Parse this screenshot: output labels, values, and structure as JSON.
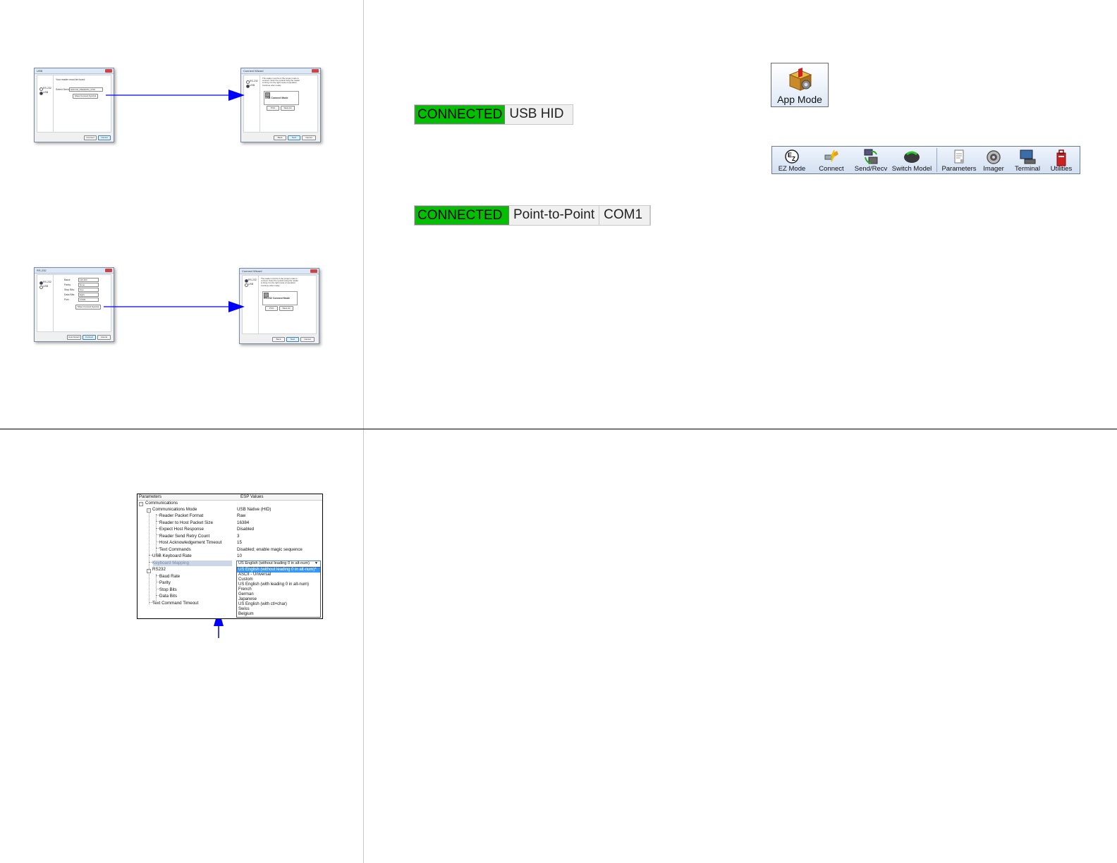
{
  "usb_wizard": {
    "title": "USB",
    "message": "Your reader must be found",
    "radio_rs232": "RS-232",
    "radio_usb": "USB",
    "device_label": "Select Device:",
    "device_value": "HID\\VID_05E0&PID_0700",
    "show_connect_button": "Show Connect Symbol",
    "connect_button": "Connect",
    "cancel_button": "Cancel"
  },
  "usb_connect_wizard": {
    "title": "Connect Wizard",
    "message": "The reader must be in the proper mode to connect. Scan the symbol using the reader to bring it to the right mode of operation. Continue when ready.",
    "radio_rs232": "RS-232",
    "radio_usb": "USB",
    "symbol_caption": "USB Connect Mode",
    "print_button": "Print",
    "save_button": "Save As",
    "back_button": "Back",
    "next_button": "Next",
    "cancel_button": "Cancel"
  },
  "rs232_wizard": {
    "title": "RS-232",
    "radio_rs232": "RS-232",
    "radio_usb": "USB",
    "fields": [
      {
        "label": "Baud:",
        "value": "115,200"
      },
      {
        "label": "Parity:",
        "value": "None"
      },
      {
        "label": "Stop Bits:",
        "value": "One"
      },
      {
        "label": "Data Bits:",
        "value": "Eight"
      },
      {
        "label": "Port:",
        "value": "COM1"
      }
    ],
    "show_connect_button": "Show Connect Symbol",
    "auto_detect_button": "Auto Detect",
    "connect_button": "Connect",
    "cancel_button": "Cancel"
  },
  "rs232_connect_wizard": {
    "title": "Connect Wizard",
    "message": "The reader must be in the proper mode to connect. Scan the symbol using the reader to bring it to the right mode of operation. Continue when ready.",
    "radio_rs232": "RS-232",
    "radio_usb": "USB",
    "symbol_caption": "RS-232 Connect Mode",
    "print_button": "Print",
    "save_button": "Save As",
    "back_button": "Back",
    "next_button": "Next",
    "cancel_button": "Cancel"
  },
  "status_usb": {
    "connected": "CONNECTED",
    "mode": "USB HID"
  },
  "status_rs232": {
    "connected": "CONNECTED",
    "mode": "Point-to-Point",
    "port": "COM1"
  },
  "app_mode": {
    "label": "App Mode"
  },
  "toolbar": {
    "items": [
      "EZ Mode",
      "Connect",
      "Send/Recv",
      "Switch Model",
      "Parameters",
      "Imager",
      "Terminal",
      "Utilities"
    ]
  },
  "param_grid": {
    "col_params": "Parameters",
    "col_values": "ESP Values",
    "rows": [
      {
        "label": "Communications",
        "value": ""
      },
      {
        "label": "Communications Mode",
        "value": "USB Native (HID)"
      },
      {
        "label": "Reader Packet Format",
        "value": "Raw"
      },
      {
        "label": "Reader to Host Packet Size",
        "value": "16384"
      },
      {
        "label": "Expect Host Response",
        "value": "Disabled"
      },
      {
        "label": "Reader Send Retry Count",
        "value": "3"
      },
      {
        "label": "Host Acknowledgement Timeout",
        "value": "15"
      },
      {
        "label": "Text Commands",
        "value": "Disabled; enable magic sequence"
      },
      {
        "label": "USB Keyboard Rate",
        "value": "10"
      },
      {
        "label": "Keyboard Mapping",
        "value": "US English (without leading 0 in alt-num)"
      },
      {
        "label": "RS232",
        "value": ""
      },
      {
        "label": "Baud Rate",
        "value": ""
      },
      {
        "label": "Parity",
        "value": ""
      },
      {
        "label": "Stop Bits",
        "value": ""
      },
      {
        "label": "Data Bits",
        "value": ""
      },
      {
        "label": "Text Command Timeout",
        "value": ""
      }
    ],
    "dropdown_options": [
      "US English (without leading 0 in alt-num)*",
      "ASCII - Universal",
      "Custom",
      "US English (with leading 0 in alt-num)",
      "French",
      "German",
      "Japanese",
      "US English (with ctl+char)",
      "Swiss",
      "Belgium"
    ]
  },
  "colors": {
    "connected": "#00c000",
    "arrow": "#0000ff",
    "selection": "#3399ff"
  }
}
